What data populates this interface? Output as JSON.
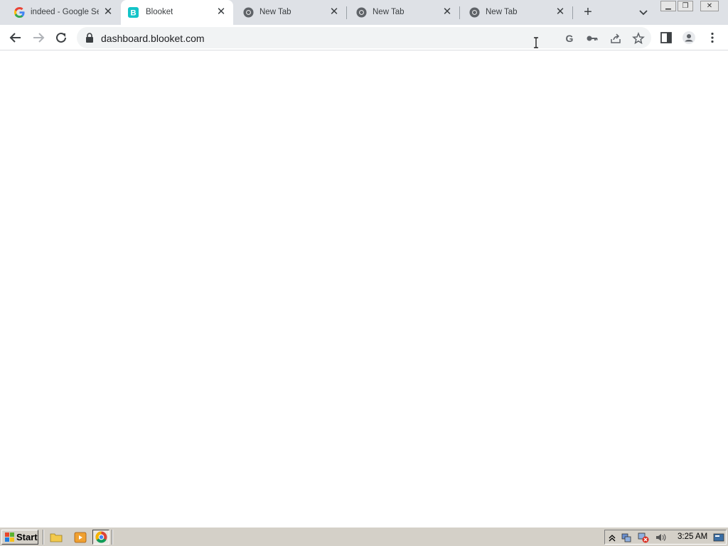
{
  "tabs": [
    {
      "title": "indeed - Google Se",
      "icon": "google-icon",
      "active": false
    },
    {
      "title": "Blooket",
      "icon": "blooket-icon",
      "active": true
    },
    {
      "title": "New Tab",
      "icon": "chrome-icon",
      "active": false
    },
    {
      "title": "New Tab",
      "icon": "chrome-icon",
      "active": false
    },
    {
      "title": "New Tab",
      "icon": "chrome-icon",
      "active": false
    }
  ],
  "toolbar": {
    "url": "dashboard.blooket.com"
  },
  "taskbar": {
    "start_label": "Start",
    "clock": "3:25 AM"
  },
  "colors": {
    "tabstrip_bg": "#dee1e6",
    "blooket_brand": "#14c4c8",
    "taskbar_bg": "#d4d0c8"
  }
}
